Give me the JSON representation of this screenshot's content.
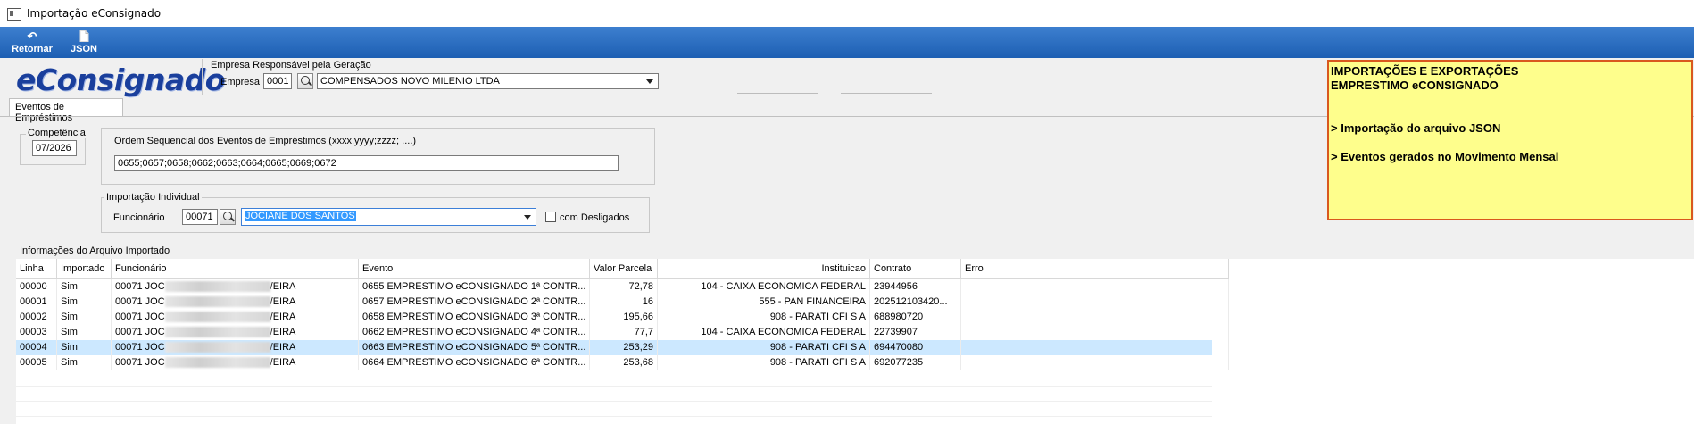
{
  "window": {
    "title": "Importação eConsignado"
  },
  "toolbar": {
    "retornar_label": "Retornar",
    "json_label": "JSON"
  },
  "header": {
    "logo_text": "eConsignado",
    "empresa_group_label": "Empresa Responsável pela Geração",
    "empresa_label": "Empresa",
    "empresa_code": "0001",
    "empresa_name": "COMPENSADOS NOVO MILENIO LTDA"
  },
  "tabs": [
    {
      "label": "Eventos de Empréstimos"
    }
  ],
  "competencia": {
    "label": "Competência",
    "value": "07/2026"
  },
  "ordem": {
    "label": "Ordem Sequencial dos Eventos de Empréstimos  (xxxx;yyyy;zzzz; ....)",
    "value": "0655;0657;0658;0662;0663;0664;0665;0669;0672"
  },
  "individual": {
    "group_label": "Importação Individual",
    "funcionario_label": "Funcionário",
    "funcionario_code": "00071",
    "funcionario_name": "JOCIANE DOS SANTOS",
    "desligados_label": "com Desligados"
  },
  "note": {
    "lines": [
      "IMPORTAÇÕES E EXPORTAÇÕES",
      "EMPRESTIMO eCONSIGNADO",
      "> Importação do arquivo JSON",
      "> Eventos gerados no Movimento Mensal"
    ]
  },
  "table": {
    "section_label": "Informações do Arquivo Importado",
    "columns": [
      "Linha",
      "Importado",
      "Funcionário",
      "Evento",
      "Valor Parcela",
      "Instituicao",
      "Contrato",
      "Erro"
    ],
    "rows": [
      [
        "00000",
        "Sim",
        "00071 JOC",
        "/EIRA",
        "0655 EMPRESTIMO eCONSIGNADO 1ª CONTR...",
        "72,78",
        "104 - CAIXA ECONOMICA FEDERAL",
        "23944956",
        ""
      ],
      [
        "00001",
        "Sim",
        "00071 JOC",
        "/EIRA",
        "0657 EMPRESTIMO eCONSIGNADO 2ª CONTR...",
        "16",
        "555 - PAN FINANCEIRA",
        "202512103420...",
        ""
      ],
      [
        "00002",
        "Sim",
        "00071 JOC",
        "/EIRA",
        "0658 EMPRESTIMO eCONSIGNADO 3ª CONTR...",
        "195,66",
        "908 - PARATI CFI S A",
        "688980720",
        ""
      ],
      [
        "00003",
        "Sim",
        "00071 JOC",
        "/EIRA",
        "0662 EMPRESTIMO eCONSIGNADO 4ª CONTR...",
        "77,7",
        "104 - CAIXA ECONOMICA FEDERAL",
        "22739907",
        ""
      ],
      [
        "00004",
        "Sim",
        "00071 JOC",
        "/EIRA",
        "0663 EMPRESTIMO eCONSIGNADO 5ª CONTR...",
        "253,29",
        "908 - PARATI CFI S A",
        "694470080",
        ""
      ],
      [
        "00005",
        "Sim",
        "00071 JOC",
        "/EIRA",
        "0664 EMPRESTIMO eCONSIGNADO 6ª CONTR...",
        "253,68",
        "908 - PARATI CFI S A",
        "692077235",
        ""
      ]
    ],
    "selected_row": 4
  },
  "colors": {
    "toolbar": "#2a6bc0",
    "note_bg": "#fefe8c",
    "note_border": "#d9581e",
    "selection": "#cce8ff",
    "logo": "#1a3f9c"
  }
}
